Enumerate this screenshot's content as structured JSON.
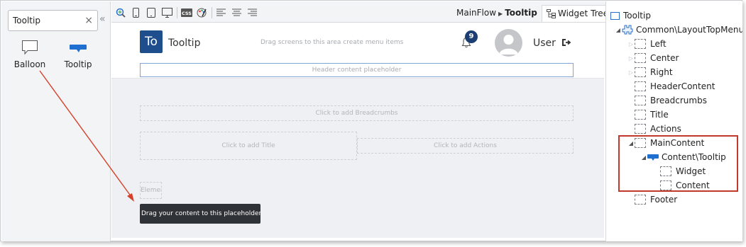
{
  "palette": {
    "search_value": "Tooltip",
    "clear_symbol": "×",
    "collapse_symbol": "«",
    "items": [
      {
        "label": "Balloon",
        "icon": "balloon-icon"
      },
      {
        "label": "Tooltip",
        "icon": "tooltip-icon"
      }
    ]
  },
  "toolbar": {
    "css_label": "CSS",
    "breadcrumb": {
      "flow": "MainFlow",
      "separator": "▶",
      "screen": "Tooltip"
    },
    "widget_tree_tab": "Widget Tree"
  },
  "canvas": {
    "logo_text": "To",
    "app_title": "Tooltip",
    "menu_hint": "Drag screens to this area create menu items",
    "notification_count": "9",
    "user_name": "User",
    "header_placeholder": "Header content placeholder",
    "breadcrumbs_placeholder": "Click to add Breadcrumbs",
    "title_placeholder": "Click to add Title",
    "actions_placeholder": "Click to add Actions",
    "element_placeholder": "Elemen",
    "tooltip_content": "Drag your content to this placeholder."
  },
  "tree": {
    "root": "Tooltip",
    "nodes": [
      {
        "label": "Common\\LayoutTopMenu"
      },
      {
        "label": "Left"
      },
      {
        "label": "Center"
      },
      {
        "label": "Right"
      },
      {
        "label": "HeaderContent"
      },
      {
        "label": "Breadcrumbs"
      },
      {
        "label": "Title"
      },
      {
        "label": "Actions"
      },
      {
        "label": "MainContent"
      },
      {
        "label": "Content\\Tooltip"
      },
      {
        "label": "Widget"
      },
      {
        "label": "Content"
      },
      {
        "label": "Footer"
      }
    ]
  },
  "colors": {
    "accent": "#1f4e8c",
    "highlight": "#c0392b",
    "arrow": "#d6402a",
    "tooltip_bg": "#2f3236"
  }
}
